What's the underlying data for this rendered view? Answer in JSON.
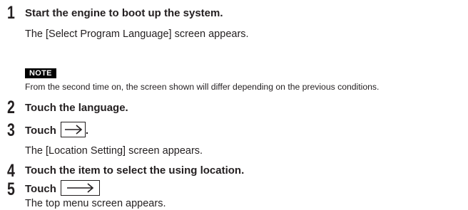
{
  "steps": [
    {
      "number": "1",
      "title": "Start the engine to boot up the system.",
      "detail": "The [Select Program Language] screen appears."
    },
    {
      "number": "2",
      "title": "Touch the language."
    },
    {
      "number": "3",
      "title": "Touch",
      "suffix": ".",
      "button_icon": "right-arrow-icon",
      "detail": "The [Location Setting] screen appears."
    },
    {
      "number": "4",
      "title": "Touch the item to select the using location."
    },
    {
      "number": "5",
      "title": "Touch",
      "suffix": "",
      "button_icon": "right-arrow-icon",
      "detail": "The top menu screen appears."
    }
  ],
  "note": {
    "label": "NOTE",
    "text": "From the second time on, the screen shown will differ depending on the previous conditions."
  }
}
